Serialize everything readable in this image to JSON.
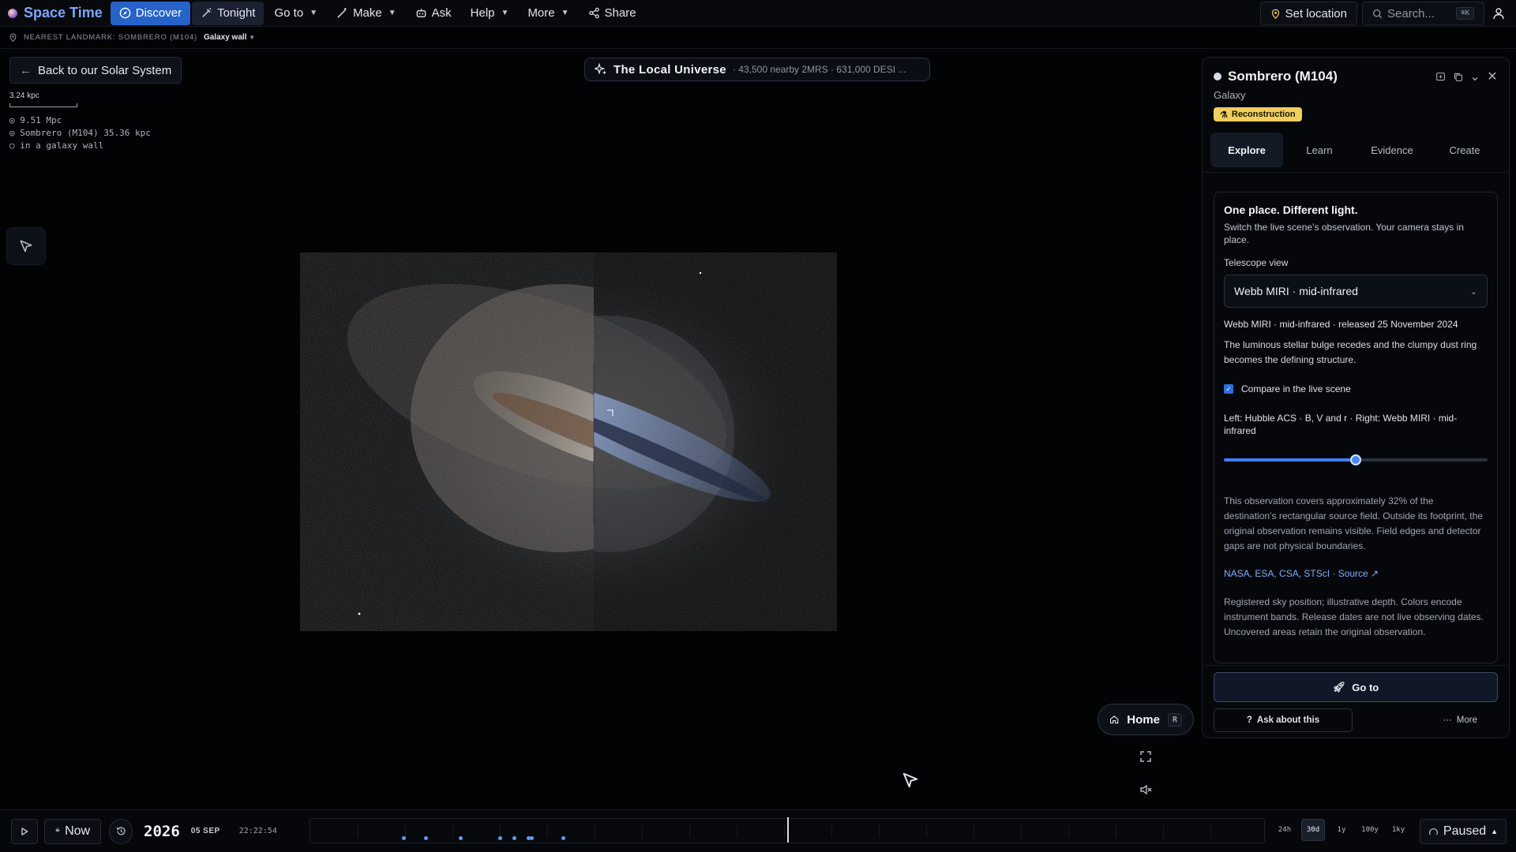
{
  "app": {
    "brand": "Space Time",
    "brand_icon": "planet-logo"
  },
  "nav": {
    "discover": "Discover",
    "tonight": "Tonight",
    "goto": "Go to",
    "make": "Make",
    "ask": "Ask",
    "help": "Help",
    "more": "More",
    "share": "Share",
    "set_location": "Set location",
    "search_placeholder": "Search...",
    "search_shortcut": "⌘K"
  },
  "subbar": {
    "landmark_label": "NEAREST LANDMARK: SOMBRERO (M104)",
    "wall": "Galaxy wall"
  },
  "view": {
    "back_label": "Back to our Solar System",
    "scale_label": "3.24 kpc",
    "readout": [
      "9.51 Mpc",
      "Sombrero (M104) 35.36 kpc",
      "in a galaxy wall"
    ]
  },
  "universe": {
    "title": "The Local Universe",
    "subtitle": "· 43,500 nearby 2MRS · 631,000 DESI ..."
  },
  "panel": {
    "title": "Sombrero (M104)",
    "kind": "Galaxy",
    "badge": "Reconstruction",
    "tabs": [
      {
        "label": "Explore",
        "active": true
      },
      {
        "label": "Learn",
        "active": false
      },
      {
        "label": "Evidence",
        "active": false
      },
      {
        "label": "Create",
        "active": false
      }
    ],
    "card": {
      "heading": "One place. Different light.",
      "description": "Switch the live scene’s observation. Your camera stays in place.",
      "telescope_label": "Telescope view",
      "telescope_value": "Webb MIRI · mid-infrared",
      "release": "Webb MIRI · mid-infrared · released 25 November 2024",
      "summary": "The luminous stellar bulge recedes and the clumpy dust ring becomes the defining structure.",
      "compare_label": "Compare in the live scene",
      "compare_checked": true,
      "compare_detail": "Left: Hubble ACS · B, V and r · Right: Webb MIRI · mid-infrared",
      "slider_fraction": 0.5,
      "coverage": "This observation covers approximately 32% of the destination’s rectangular source field. Outside its footprint, the original observation remains visible. Field edges and detector gaps are not physical boundaries.",
      "credit": "NASA, ESA, CSA, STScI · Source ↗",
      "disclaimer": "Registered sky position; illustrative depth. Colors encode instrument bands. Release dates are not live observing dates. Uncovered areas retain the original observation."
    },
    "goto": "Go to",
    "ask": "Ask about this",
    "more": "More"
  },
  "controls": {
    "home": "Home",
    "home_key": "R"
  },
  "timeline": {
    "now": "Now",
    "year": "2026",
    "date": "05 SEP",
    "time": "22:22:54",
    "zoom_options": [
      {
        "label": "24h",
        "active": false
      },
      {
        "label": "30d",
        "active": true
      },
      {
        "label": "1y",
        "active": false
      },
      {
        "label": "100y",
        "active": false
      },
      {
        "label": "1ky",
        "active": false
      }
    ],
    "status": "Paused"
  },
  "colors": {
    "accent": "#2563c9",
    "badge": "#f0cf5f",
    "event_dot": "#5e9cf2"
  }
}
